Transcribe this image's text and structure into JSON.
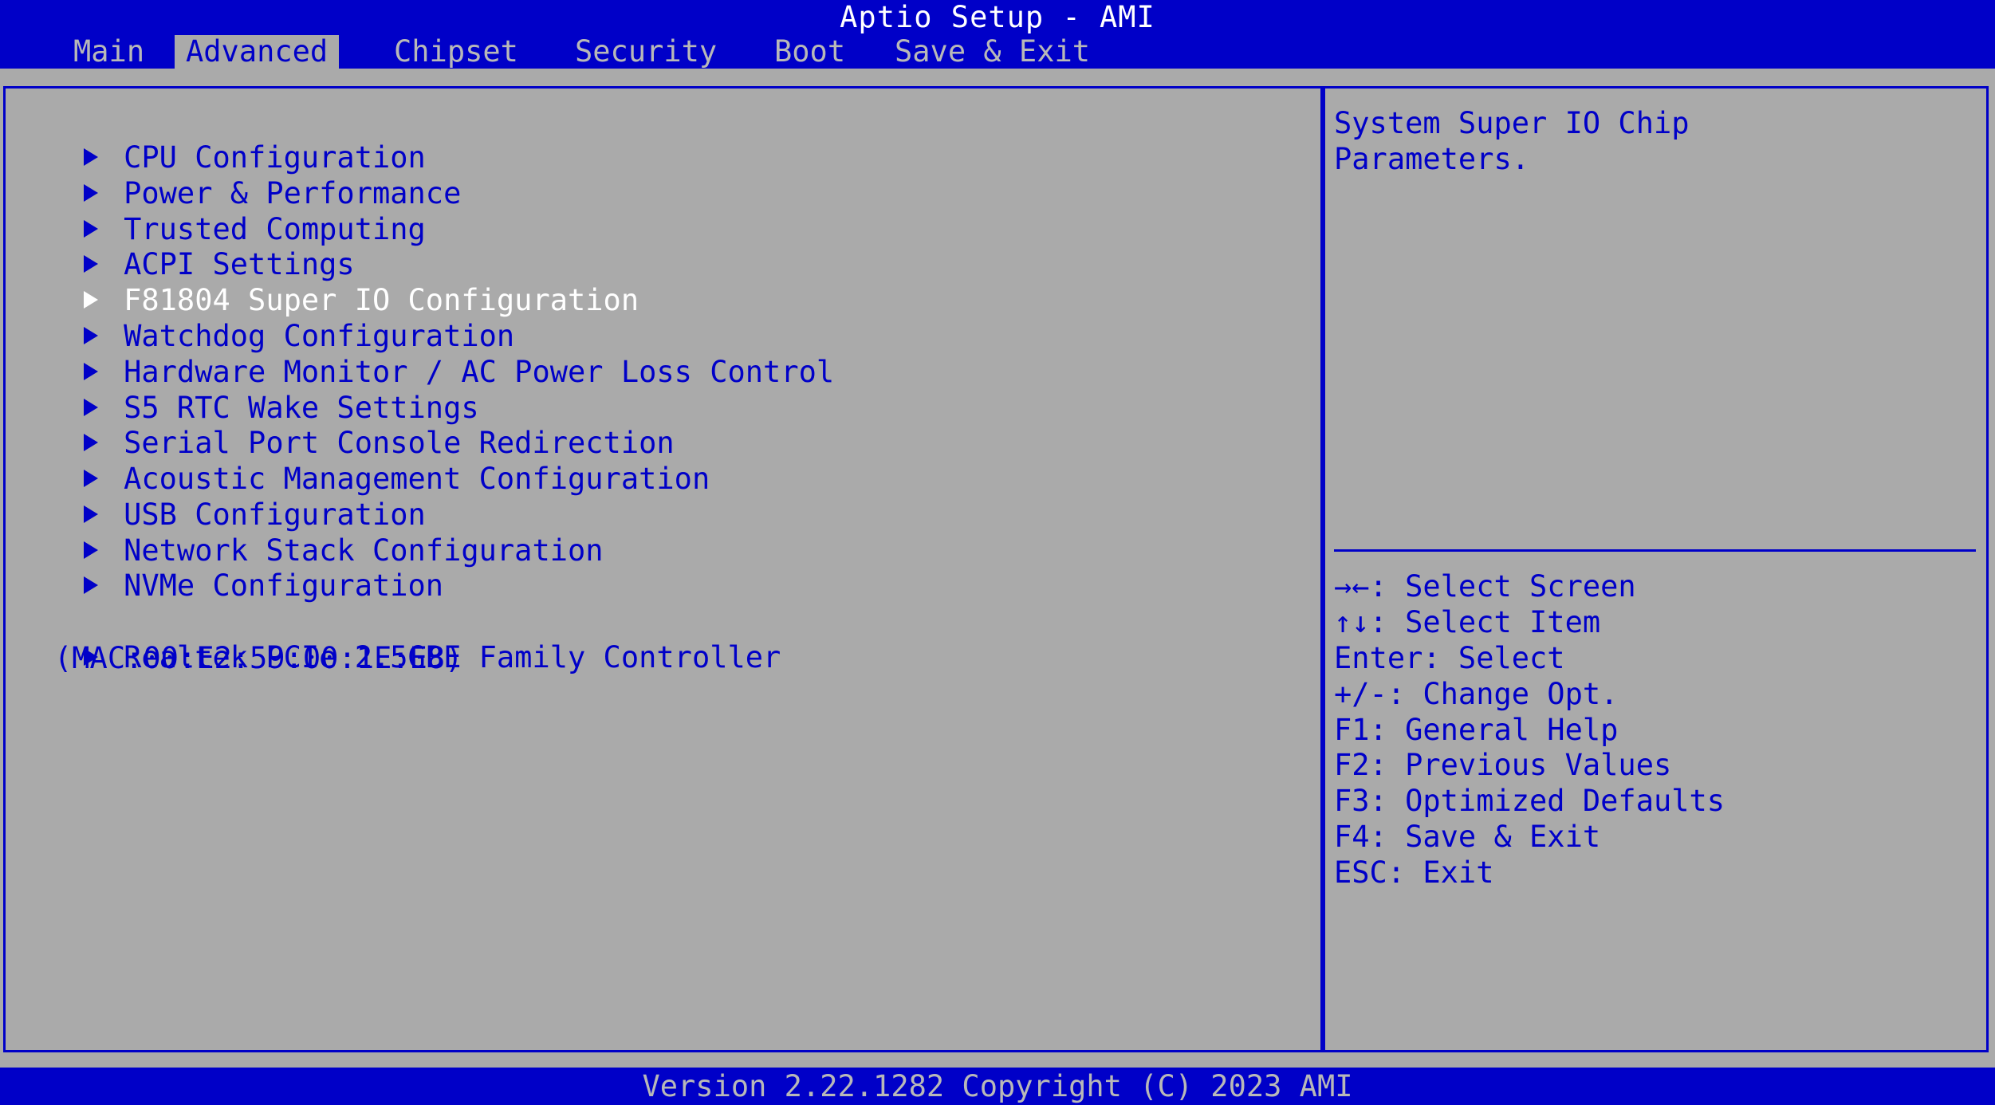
{
  "header": {
    "title": "Aptio Setup - AMI"
  },
  "tabs": [
    {
      "label": "Main"
    },
    {
      "label": "Advanced"
    },
    {
      "label": "Chipset"
    },
    {
      "label": "Security"
    },
    {
      "label": "Boot"
    },
    {
      "label": "Save & Exit"
    }
  ],
  "active_tab": "Advanced",
  "menu": {
    "items": [
      {
        "label": "CPU Configuration"
      },
      {
        "label": "Power & Performance"
      },
      {
        "label": "Trusted Computing"
      },
      {
        "label": "ACPI Settings"
      },
      {
        "label": "F81804 Super IO Configuration"
      },
      {
        "label": "Watchdog Configuration"
      },
      {
        "label": "Hardware Monitor / AC Power Loss Control"
      },
      {
        "label": "S5 RTC Wake Settings"
      },
      {
        "label": "Serial Port Console Redirection"
      },
      {
        "label": "Acoustic Management Configuration"
      },
      {
        "label": "USB Configuration"
      },
      {
        "label": "Network Stack Configuration"
      },
      {
        "label": "NVMe Configuration"
      },
      {
        "label": "Realtek PCIe 2.5GBE Family Controller",
        "subline": "(MAC:00:E2:59:00:1E:E8)"
      }
    ],
    "selected": "F81804 Super IO Configuration"
  },
  "help": {
    "description_line1": "System Super IO Chip",
    "description_line2": "Parameters.",
    "keys": [
      "→←: Select Screen",
      "↑↓: Select Item",
      "Enter: Select",
      "+/-: Change Opt.",
      "F1: General Help",
      "F2: Previous Values",
      "F3: Optimized Defaults",
      "F4: Save & Exit",
      "ESC: Exit"
    ]
  },
  "footer": {
    "version": "Version 2.22.1282 Copyright (C) 2023 AMI"
  },
  "colors": {
    "background": "#aaaaaa",
    "bar": "#0000c8",
    "text": "#0000c8",
    "highlight_text": "#ffffff",
    "inactive_tab_text": "#b8b8b8"
  }
}
